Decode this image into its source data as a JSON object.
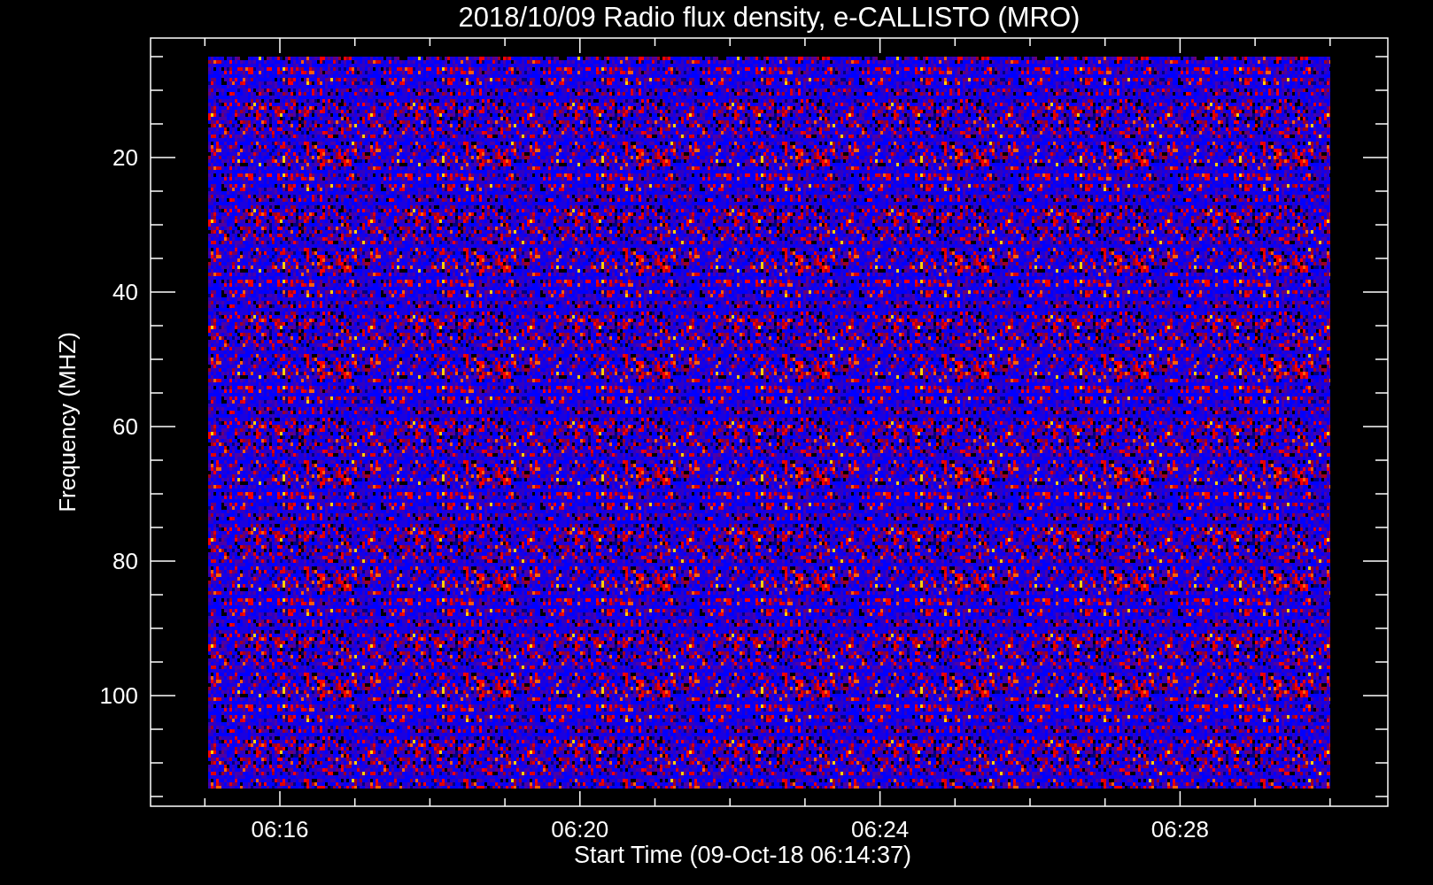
{
  "title": "2018/10/09  Radio flux density, e-CALLISTO (MRO)",
  "ylabel": "Frequency (MHZ)",
  "xlabel": "Start Time (09-Oct-18 06:14:37)",
  "yticks": [
    "20",
    "40",
    "60",
    "80",
    "100"
  ],
  "xticks": [
    "06:16",
    "06:20",
    "06:24",
    "06:28"
  ]
}
